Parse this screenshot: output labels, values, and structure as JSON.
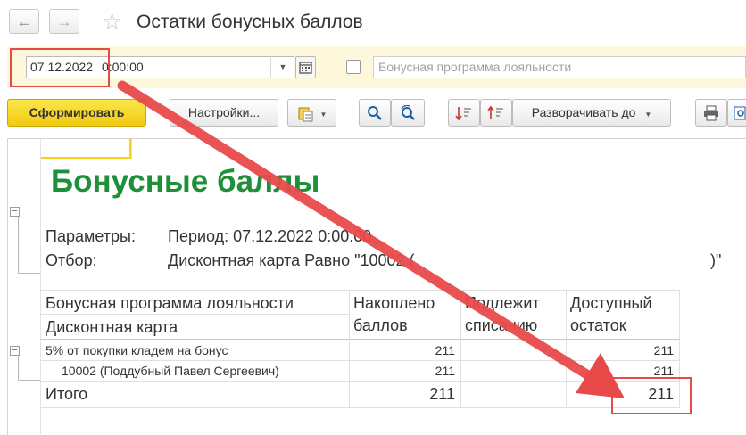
{
  "window": {
    "title": "Остатки бонусных баллов",
    "back_icon": "←",
    "forward_icon": "→",
    "star_icon": "☆"
  },
  "params": {
    "date": "07.12.2022",
    "time": "0:00:00",
    "program_placeholder": "Бонусная программа лояльности"
  },
  "toolbar": {
    "generate_label": "Сформировать",
    "settings_label": "Настройки...",
    "expand_label": "Разворачивать до"
  },
  "report": {
    "title": "Бонусные баллы",
    "params_label": "Параметры:",
    "params_value": "Период: 07.12.2022 0:00:00",
    "filter_label": "Отбор:",
    "filter_value": "Дисконтная карта Равно \"10002 (",
    "filter_tail": ")\"",
    "headers": {
      "col1_line1": "Бонусная программа лояльности",
      "col1_line2": "Дисконтная карта",
      "col2_line1": "Накоплено",
      "col2_line2": "баллов",
      "col3_line1": "Подлежит",
      "col3_line2": "списанию",
      "col4_line1": "Доступный",
      "col4_line2": "остаток"
    },
    "rows": [
      {
        "name": "5% от покупки кладем на бонус",
        "accrued": "211",
        "writeoff": "",
        "available": "211"
      },
      {
        "name": "10002 (Поддубный Павел Сергеевич)",
        "accrued": "211",
        "writeoff": "",
        "available": "211"
      }
    ],
    "total": {
      "name": "Итого",
      "accrued": "211",
      "writeoff": "",
      "available": "211"
    }
  },
  "colors": {
    "accent_yellow": "#f5d21c",
    "title_green": "#1f8f3a",
    "annotation_red": "#e84a4a"
  }
}
